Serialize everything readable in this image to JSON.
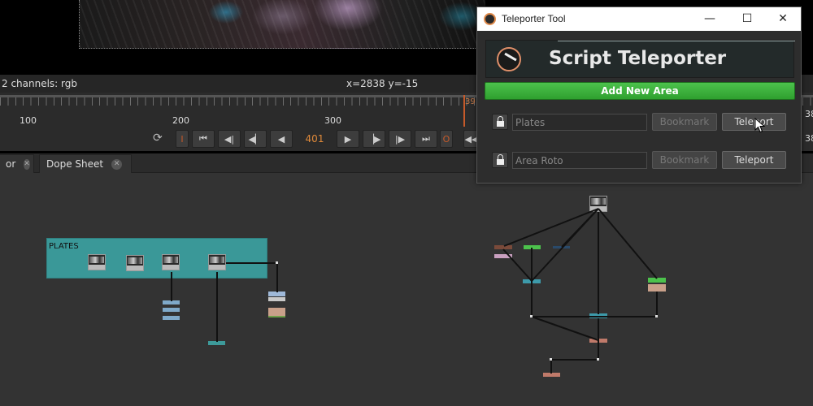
{
  "viewer": {
    "channels": "2 channels: rgb",
    "coords": "x=2838 y=-15"
  },
  "timeline": {
    "ticks": [
      "100",
      "200",
      "300"
    ],
    "current_frame": "401",
    "playhead_label": "39",
    "right_labels": [
      "38",
      "38"
    ]
  },
  "tabs": [
    {
      "label": "or"
    },
    {
      "label": "Dope Sheet"
    }
  ],
  "node_graph": {
    "backdrop_label": "PLATES"
  },
  "teleporter": {
    "window_title": "Teleporter Tool",
    "heading": "Script Teleporter",
    "add_area_label": "Add New Area",
    "areas": [
      {
        "placeholder": "Plates",
        "bookmark_label": "Bookmark",
        "teleport_label": "Teleport"
      },
      {
        "placeholder": "Area Roto",
        "bookmark_label": "Bookmark",
        "teleport_label": "Teleport"
      }
    ]
  },
  "colors": {
    "accent_orange": "#e08a3a",
    "add_button_green": "#3cb43c",
    "backdrop_teal": "#3a9898"
  }
}
